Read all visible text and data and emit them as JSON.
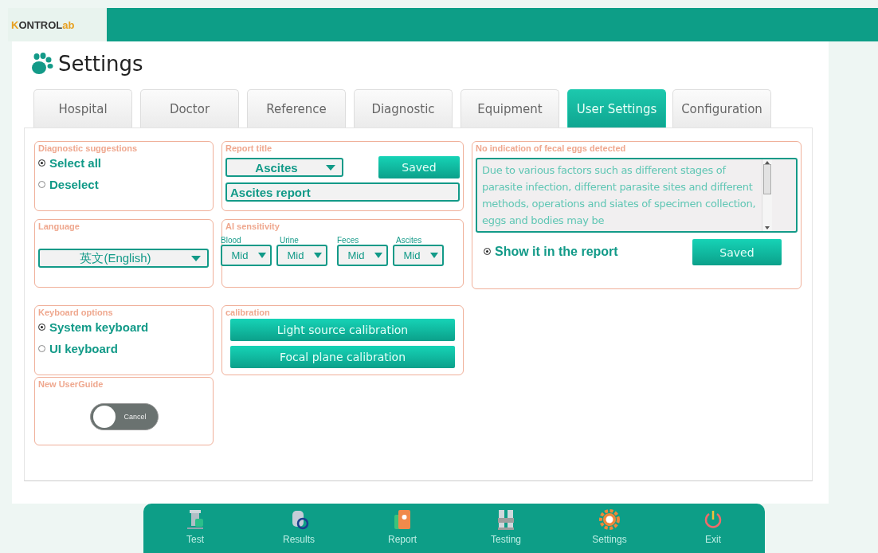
{
  "header": {
    "logo": [
      {
        "text": "K",
        "accent": true
      },
      {
        "text": "ONTROL",
        "accent": false
      },
      {
        "text": "ab",
        "accent": true
      }
    ]
  },
  "page_title": "Settings",
  "tabs": [
    {
      "label": "Hospital",
      "selected": false
    },
    {
      "label": "Doctor",
      "selected": false
    },
    {
      "label": "Reference",
      "selected": false
    },
    {
      "label": "Diagnostic",
      "selected": false
    },
    {
      "label": "Equipment",
      "selected": false
    },
    {
      "label": "User Settings",
      "selected": true
    },
    {
      "label": "Configuration",
      "selected": false
    }
  ],
  "diagnostic_suggestions": {
    "title": "Diagnostic suggestions",
    "options": [
      {
        "label": "Select all",
        "selected": true
      },
      {
        "label": "Deselect",
        "selected": false
      }
    ]
  },
  "report_title": {
    "title": "Report title",
    "dropdown": "Ascites",
    "button": "Saved",
    "value": "Ascites report"
  },
  "language": {
    "title": "Language",
    "dropdown": "英文(English)"
  },
  "ai_sensitivity": {
    "title": "AI sensitivity",
    "items": [
      {
        "label": "Blood",
        "value": "Mid"
      },
      {
        "label": "Urine",
        "value": "Mid"
      },
      {
        "label": "Feces",
        "value": "Mid"
      },
      {
        "label": "Ascites",
        "value": "Mid"
      }
    ]
  },
  "keyboard_options": {
    "title": "Keyboard options",
    "options": [
      {
        "label": "System keyboard",
        "selected": true
      },
      {
        "label": "UI keyboard",
        "selected": false
      }
    ]
  },
  "calibration": {
    "title": "calibration",
    "buttons": [
      "Light source calibration",
      "Focal plane calibration"
    ]
  },
  "new_user_guide": {
    "title": "New UserGuide",
    "toggle": {
      "label": "Cancel",
      "on": false
    }
  },
  "no_eggs_notice": {
    "title": "No indication of fecal eggs detected",
    "text": "Due to various factors such as different stages of parasite infection, different parasite sites and different methods, operations and siates of specimen collection, eggs and bodies may be",
    "show_in_report": {
      "label": "Show it in the report",
      "checked": true
    },
    "button": "Saved"
  },
  "bottom_nav": [
    {
      "label": "Test",
      "kind": "test"
    },
    {
      "label": "Results",
      "kind": "results"
    },
    {
      "label": "Report",
      "kind": "report"
    },
    {
      "label": "Testing",
      "kind": "testing"
    },
    {
      "label": "Settings",
      "kind": "settings"
    },
    {
      "label": "Exit",
      "kind": "exit"
    }
  ]
}
